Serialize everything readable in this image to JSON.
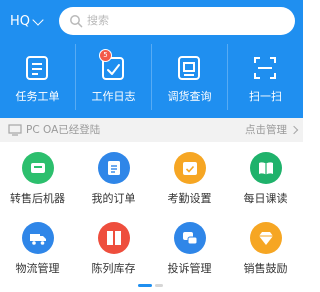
{
  "header": {
    "org_label": "HQ",
    "search_placeholder": "搜索",
    "quick_actions": [
      {
        "label": "任务工单",
        "icon": "task-ticket-icon"
      },
      {
        "label": "工作日志",
        "icon": "work-log-icon",
        "badge": "5"
      },
      {
        "label": "调货查询",
        "icon": "transfer-query-icon"
      },
      {
        "label": "扫一扫",
        "icon": "scan-icon"
      }
    ]
  },
  "login_bar": {
    "status_text": "PC OA已经登陆",
    "manage_label": "点击管理"
  },
  "grid": {
    "items": [
      {
        "label": "转售后机器",
        "icon": "after-sales-machine-icon",
        "color": "#2cbf6d"
      },
      {
        "label": "我的订单",
        "icon": "my-orders-icon",
        "color": "#2f86e8"
      },
      {
        "label": "考勤设置",
        "icon": "attendance-settings-icon",
        "color": "#f6a623"
      },
      {
        "label": "每日课读",
        "icon": "daily-reading-icon",
        "color": "#1fb26b"
      },
      {
        "label": "物流管理",
        "icon": "logistics-truck-icon",
        "color": "#2f86e8"
      },
      {
        "label": "陈列库存",
        "icon": "display-inventory-icon",
        "color": "#ee4e3d"
      },
      {
        "label": "投诉管理",
        "icon": "complaint-management-icon",
        "color": "#2f86e8"
      },
      {
        "label": "销售鼓励",
        "icon": "sales-incentive-icon",
        "color": "#f6a623"
      }
    ]
  },
  "pager": {
    "active_page": 1,
    "page_count": 2
  },
  "colors": {
    "brand_blue": "#1f8ff0",
    "login_bar_bg": "#f2f2f2"
  }
}
